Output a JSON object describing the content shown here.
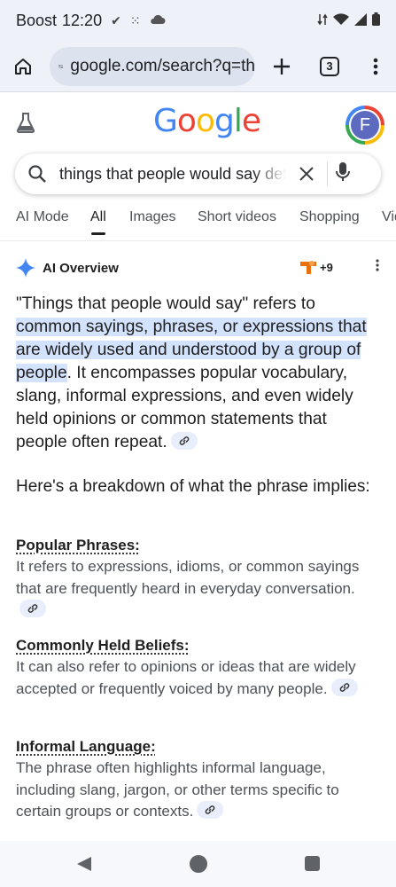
{
  "status_bar": {
    "carrier": "Boost",
    "time": "12:20"
  },
  "browser": {
    "url": "google.com/search?q=th",
    "tab_count": "3"
  },
  "google": {
    "logo_letters": [
      {
        "char": "G",
        "color": "#4285f4"
      },
      {
        "char": "o",
        "color": "#ea4335"
      },
      {
        "char": "o",
        "color": "#fbbc05"
      },
      {
        "char": "g",
        "color": "#4285f4"
      },
      {
        "char": "l",
        "color": "#34a853"
      },
      {
        "char": "e",
        "color": "#ea4335"
      }
    ],
    "avatar_letter": "F"
  },
  "search": {
    "query": "things that people would say def"
  },
  "tabs": [
    "AI Mode",
    "All",
    "Images",
    "Short videos",
    "Shopping",
    "Vid"
  ],
  "active_tab": "All",
  "ai_overview": {
    "title": "AI Overview",
    "source_count": "+9",
    "intro_start": "\"Things that people would say\" refers to ",
    "intro_highlight": "common sayings, phrases, or expressions that are widely used and understood by a group of people",
    "intro_end": ". It encompasses popular vocabulary, slang, informal expressions, and even widely held opinions or common statements that people often repeat.",
    "breakdown_heading": "Here's a breakdown of what the phrase implies:",
    "items": [
      {
        "title": "Popular Phrases:",
        "body": "It refers to expressions, idioms, or common sayings that are frequently heard in everyday conversation."
      },
      {
        "title": "Commonly Held Beliefs:",
        "body": "It can also refer to opinions or ideas that are widely accepted or frequently voiced by many people."
      },
      {
        "title": "Informal Language:",
        "body": "The phrase often highlights informal language, including slang, jargon, or other terms specific to certain groups or contexts."
      }
    ]
  },
  "colors": {
    "highlight": "#d3e3fd",
    "accent": "#1a73e8"
  }
}
